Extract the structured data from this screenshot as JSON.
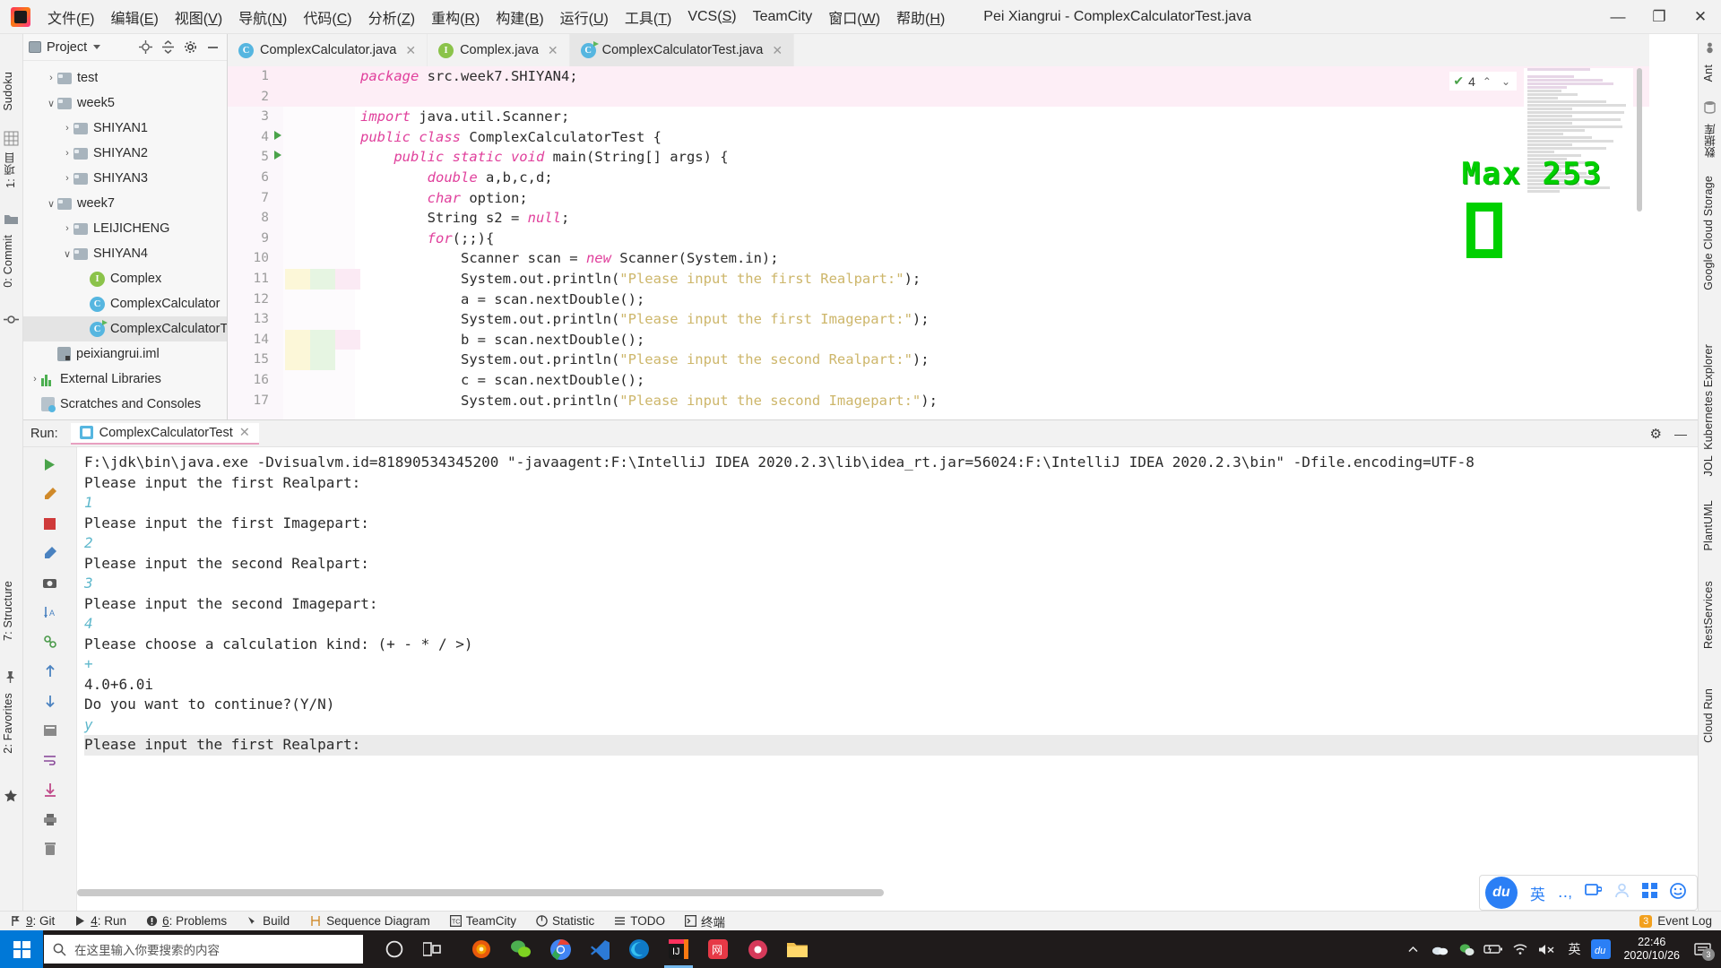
{
  "window": {
    "title": "Pei Xiangrui - ComplexCalculatorTest.java",
    "minimize": "—",
    "maximize": "❐",
    "close": "✕"
  },
  "menu": {
    "items": [
      {
        "label": "文件",
        "mnemonic": "F"
      },
      {
        "label": "编辑",
        "mnemonic": "E"
      },
      {
        "label": "视图",
        "mnemonic": "V"
      },
      {
        "label": "导航",
        "mnemonic": "N"
      },
      {
        "label": "代码",
        "mnemonic": "C"
      },
      {
        "label": "分析",
        "mnemonic": "Z"
      },
      {
        "label": "重构",
        "mnemonic": "R"
      },
      {
        "label": "构建",
        "mnemonic": "B"
      },
      {
        "label": "运行",
        "mnemonic": "U"
      },
      {
        "label": "工具",
        "mnemonic": "T"
      },
      {
        "label": "VCS",
        "mnemonic": "S"
      },
      {
        "label": "TeamCity",
        "mnemonic": ""
      },
      {
        "label": "窗口",
        "mnemonic": "W"
      },
      {
        "label": "帮助",
        "mnemonic": "H"
      }
    ]
  },
  "left_strip": {
    "tabs": [
      {
        "label": "Sudoku",
        "name": "tool-tab-sudoku"
      },
      {
        "label": "1: 项目",
        "name": "tool-tab-project"
      },
      {
        "label": "0: Commit",
        "name": "tool-tab-commit"
      },
      {
        "label": "7: Structure",
        "name": "tool-tab-structure"
      },
      {
        "label": "2: Favorites",
        "name": "tool-tab-favorites"
      }
    ]
  },
  "right_strip": {
    "tabs": [
      {
        "label": "Ant",
        "name": "tool-tab-ant"
      },
      {
        "label": "数据库",
        "name": "tool-tab-database"
      },
      {
        "label": "Google Cloud Storage",
        "name": "tool-tab-gcs"
      },
      {
        "label": "Kubernetes Explorer",
        "name": "tool-tab-kubernetes"
      },
      {
        "label": "JOL",
        "name": "tool-tab-jol"
      },
      {
        "label": "PlantUML",
        "name": "tool-tab-plantuml"
      },
      {
        "label": "RestServices",
        "name": "tool-tab-restservices"
      },
      {
        "label": "Cloud Run",
        "name": "tool-tab-cloudrun"
      }
    ]
  },
  "project_panel": {
    "title": "Project",
    "tree": [
      {
        "label": "test",
        "indent": 1,
        "arrow": "›",
        "icon": "folder"
      },
      {
        "label": "week5",
        "indent": 1,
        "arrow": "∨",
        "icon": "folder"
      },
      {
        "label": "SHIYAN1",
        "indent": 2,
        "arrow": "›",
        "icon": "folder"
      },
      {
        "label": "SHIYAN2",
        "indent": 2,
        "arrow": "›",
        "icon": "folder"
      },
      {
        "label": "SHIYAN3",
        "indent": 2,
        "arrow": "›",
        "icon": "folder"
      },
      {
        "label": "week7",
        "indent": 1,
        "arrow": "∨",
        "icon": "folder"
      },
      {
        "label": "LEIJICHENG",
        "indent": 2,
        "arrow": "›",
        "icon": "folder"
      },
      {
        "label": "SHIYAN4",
        "indent": 2,
        "arrow": "∨",
        "icon": "folder"
      },
      {
        "label": "Complex",
        "indent": 3,
        "arrow": "",
        "icon": "interface"
      },
      {
        "label": "ComplexCalculator",
        "indent": 3,
        "arrow": "",
        "icon": "class"
      },
      {
        "label": "ComplexCalculatorT",
        "indent": 3,
        "arrow": "",
        "icon": "class-test",
        "selected": true
      },
      {
        "label": "peixiangrui.iml",
        "indent": 1,
        "arrow": "",
        "icon": "iml"
      },
      {
        "label": "External Libraries",
        "indent": 0,
        "arrow": "›",
        "icon": "library"
      },
      {
        "label": "Scratches and Consoles",
        "indent": 0,
        "arrow": "",
        "icon": "scratch"
      }
    ]
  },
  "editor": {
    "tabs": [
      {
        "label": "ComplexCalculator.java",
        "icon": "class",
        "active": false
      },
      {
        "label": "Complex.java",
        "icon": "interface",
        "active": false
      },
      {
        "label": "ComplexCalculatorTest.java",
        "icon": "class-test",
        "active": true
      }
    ],
    "inspection": {
      "count": "4",
      "check": "✔",
      "up": "⌃",
      "down": "⌄"
    },
    "overlay_text": "Max 253",
    "lines": [
      {
        "n": "1",
        "band": "pink",
        "marks": "",
        "run": false,
        "tokens": [
          {
            "t": "package ",
            "c": "kw"
          },
          {
            "t": "src.week7.SHIYAN4;",
            "c": "pun"
          }
        ]
      },
      {
        "n": "2",
        "band": "pink",
        "marks": "",
        "run": false,
        "tokens": []
      },
      {
        "n": "3",
        "band": "",
        "marks": "",
        "run": false,
        "tokens": [
          {
            "t": "import ",
            "c": "kw"
          },
          {
            "t": "java.util.Scanner;",
            "c": "pun"
          }
        ]
      },
      {
        "n": "4",
        "band": "",
        "marks": "",
        "run": true,
        "tokens": [
          {
            "t": "public class ",
            "c": "kw"
          },
          {
            "t": "ComplexCalculatorTest {",
            "c": "pun"
          }
        ]
      },
      {
        "n": "5",
        "band": "",
        "marks": "",
        "run": true,
        "tokens": [
          {
            "t": "    ",
            "c": "pun"
          },
          {
            "t": "public static void ",
            "c": "kw"
          },
          {
            "t": "main(String[] args) {",
            "c": "pun"
          }
        ]
      },
      {
        "n": "6",
        "band": "",
        "marks": "",
        "run": false,
        "tokens": [
          {
            "t": "        ",
            "c": "pun"
          },
          {
            "t": "double ",
            "c": "kw"
          },
          {
            "t": "a,b,c,d;",
            "c": "pun"
          }
        ]
      },
      {
        "n": "7",
        "band": "",
        "marks": "",
        "run": false,
        "tokens": [
          {
            "t": "        ",
            "c": "pun"
          },
          {
            "t": "char ",
            "c": "kw"
          },
          {
            "t": "option;",
            "c": "pun"
          }
        ]
      },
      {
        "n": "8",
        "band": "",
        "marks": "",
        "run": false,
        "tokens": [
          {
            "t": "        String s2 = ",
            "c": "pun"
          },
          {
            "t": "null",
            "c": "kw"
          },
          {
            "t": ";",
            "c": "pun"
          }
        ]
      },
      {
        "n": "9",
        "band": "",
        "marks": "",
        "run": false,
        "tokens": [
          {
            "t": "        ",
            "c": "pun"
          },
          {
            "t": "for",
            "c": "kw"
          },
          {
            "t": "(;;){",
            "c": "pun"
          }
        ]
      },
      {
        "n": "10",
        "band": "",
        "marks": "",
        "run": false,
        "tokens": [
          {
            "t": "            Scanner scan = ",
            "c": "pun"
          },
          {
            "t": "new ",
            "c": "kw"
          },
          {
            "t": "Scanner(System.in);",
            "c": "pun"
          }
        ]
      },
      {
        "n": "11",
        "band": "",
        "marks": "ygp",
        "run": false,
        "tokens": [
          {
            "t": "            System.out.println(",
            "c": "pun"
          },
          {
            "t": "\"Please input the first Realpart:\"",
            "c": "str"
          },
          {
            "t": ");",
            "c": "pun"
          }
        ]
      },
      {
        "n": "12",
        "band": "",
        "marks": "",
        "run": false,
        "tokens": [
          {
            "t": "            a = scan.nextDouble();",
            "c": "pun"
          }
        ]
      },
      {
        "n": "13",
        "band": "",
        "marks": "",
        "run": false,
        "tokens": [
          {
            "t": "            System.out.println(",
            "c": "pun"
          },
          {
            "t": "\"Please input the first Imagepart:\"",
            "c": "str"
          },
          {
            "t": ");",
            "c": "pun"
          }
        ]
      },
      {
        "n": "14",
        "band": "",
        "marks": "ygp",
        "run": false,
        "tokens": [
          {
            "t": "            b = scan.nextDouble();",
            "c": "pun"
          }
        ]
      },
      {
        "n": "15",
        "band": "",
        "marks": "yg",
        "run": false,
        "tokens": [
          {
            "t": "            System.out.println(",
            "c": "pun"
          },
          {
            "t": "\"Please input the second Realpart:\"",
            "c": "str"
          },
          {
            "t": ");",
            "c": "pun"
          }
        ]
      },
      {
        "n": "16",
        "band": "",
        "marks": "",
        "run": false,
        "tokens": [
          {
            "t": "            c = scan.nextDouble();",
            "c": "pun"
          }
        ]
      },
      {
        "n": "17",
        "band": "",
        "marks": "",
        "run": false,
        "tokens": [
          {
            "t": "            System.out.println(",
            "c": "pun"
          },
          {
            "t": "\"Please input the second Imagepart:\"",
            "c": "str"
          },
          {
            "t": ");",
            "c": "pun"
          }
        ]
      }
    ]
  },
  "run_panel": {
    "label": "Run:",
    "config_name": "ComplexCalculatorTest",
    "close": "✕",
    "settings_icon": "⚙",
    "minimize_icon": "—",
    "console_lines": [
      {
        "text": "F:\\jdk\\bin\\java.exe -Dvisualvm.id=81890534345200 \"-javaagent:F:\\IntelliJ IDEA 2020.2.3\\lib\\idea_rt.jar=56024:F:\\IntelliJ IDEA 2020.2.3\\bin\" -Dfile.encoding=UTF-8",
        "kind": "out"
      },
      {
        "text": "Please input the first Realpart:",
        "kind": "out"
      },
      {
        "text": "1",
        "kind": "in"
      },
      {
        "text": "Please input the first Imagepart:",
        "kind": "out"
      },
      {
        "text": "2",
        "kind": "in"
      },
      {
        "text": "Please input the second Realpart:",
        "kind": "out"
      },
      {
        "text": "3",
        "kind": "in"
      },
      {
        "text": "Please input the second Imagepart:",
        "kind": "out"
      },
      {
        "text": "4",
        "kind": "in"
      },
      {
        "text": "Please choose a calculation kind: (+ - * / >)",
        "kind": "out"
      },
      {
        "text": "+",
        "kind": "in"
      },
      {
        "text": "4.0+6.0i",
        "kind": "out"
      },
      {
        "text": "Do you want to continue?(Y/N)",
        "kind": "out"
      },
      {
        "text": "y",
        "kind": "in"
      },
      {
        "text": "Please input the first Realpart:",
        "kind": "out-dim"
      }
    ]
  },
  "statusbar": {
    "items": [
      {
        "label": "9: Git",
        "icon": "branch-icon",
        "name": "status-git"
      },
      {
        "label": "4: Run",
        "icon": "run-icon",
        "name": "status-run"
      },
      {
        "label": "6: Problems",
        "icon": "problems-icon",
        "name": "status-problems"
      },
      {
        "label": "Build",
        "icon": "build-icon",
        "name": "status-build"
      },
      {
        "label": "Sequence Diagram",
        "icon": "sequence-icon",
        "name": "status-sequence-diagram"
      },
      {
        "label": "TeamCity",
        "icon": "teamcity-icon",
        "name": "status-teamcity"
      },
      {
        "label": "Statistic",
        "icon": "statistic-icon",
        "name": "status-statistic"
      },
      {
        "label": "TODO",
        "icon": "todo-icon",
        "name": "status-todo"
      },
      {
        "label": "终端",
        "icon": "terminal-icon",
        "name": "status-terminal"
      }
    ],
    "event_log": {
      "label": "Event Log",
      "badge": "3"
    }
  },
  "ime_bar": {
    "logo": "du",
    "mode": "英",
    "punct": "‥,",
    "items": [
      "keyboard-icon",
      "user-icon",
      "apps-icon",
      "emoji-icon"
    ]
  },
  "taskbar": {
    "search_placeholder": "在这里输入你要搜索的内容",
    "apps": [
      "cortana-icon",
      "taskview-icon",
      "firefox-icon",
      "wechat-icon",
      "chrome-icon",
      "vscode-icon",
      "edge-icon",
      "idea-icon",
      "netease-icon",
      "recorder-icon",
      "explorer-icon"
    ],
    "tray": [
      "chevron-up-icon",
      "onedrive-icon",
      "wechat-tray-icon",
      "battery-icon",
      "wifi-icon",
      "volume-muted-icon",
      "ime-en-icon",
      "baidu-icon"
    ],
    "clock_time": "22:46",
    "clock_date": "2020/10/26",
    "notification_count": "3"
  }
}
